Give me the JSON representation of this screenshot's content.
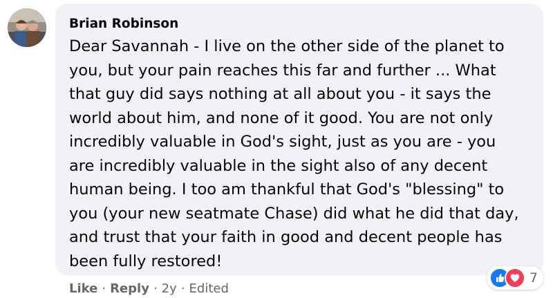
{
  "comment": {
    "author": "Brian Robinson",
    "text": "Dear Savannah - I live on the other side of the planet to you, but your pain reaches this far and further ... What that guy did says nothing at all about you - it says the world about him, and none of it good. You are not only incredibly valuable in God's sight, just as you are - you are incredibly valuable in the sight also of any decent human being. I too am thankful that God's \"blessing\" to you (your new seatmate Chase) did what he did that day, and trust that your faith in good and decent people has been fully restored!",
    "reactions": {
      "icons": [
        "like-icon",
        "love-icon"
      ],
      "count": "7",
      "like_color": "#1877f2",
      "love_color": "#f33e58"
    },
    "actions": {
      "like": "Like",
      "reply": "Reply",
      "separator": "·",
      "age": "2y",
      "edited": "Edited"
    }
  }
}
